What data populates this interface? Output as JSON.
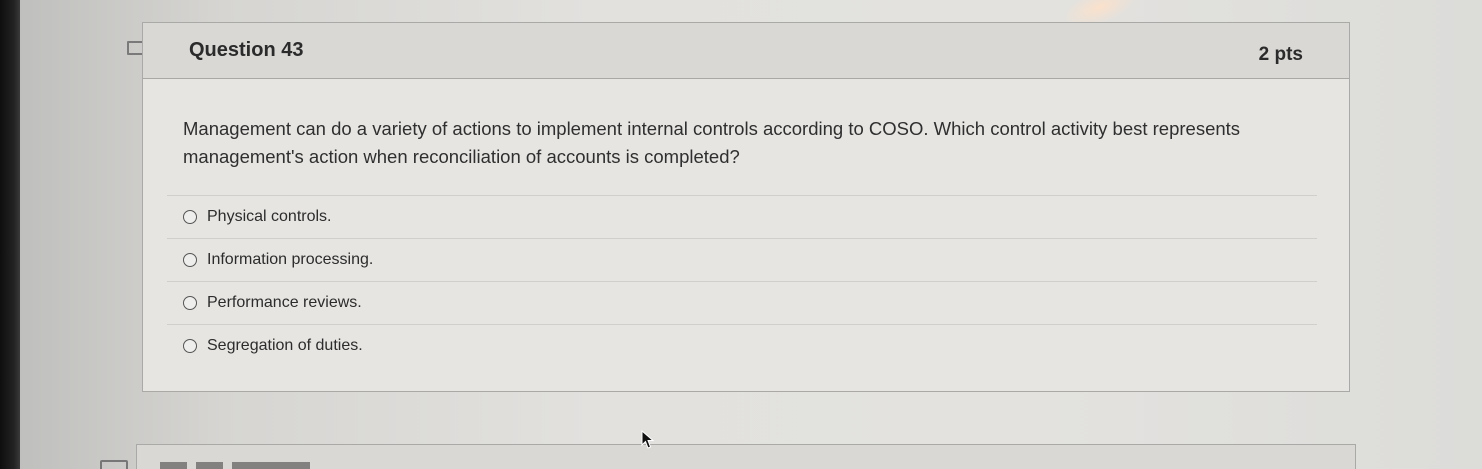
{
  "question": {
    "title": "Question 43",
    "points": "2 pts",
    "text": "Management can do a variety of actions to implement internal controls according to COSO. Which control activity best represents management's action when reconciliation of accounts is completed?",
    "answers": [
      {
        "label": "Physical controls."
      },
      {
        "label": "Information processing."
      },
      {
        "label": "Performance reviews."
      },
      {
        "label": "Segregation of duties."
      }
    ]
  },
  "icons": {
    "flag": "bookmark-flag-icon",
    "radio": "radio-unselected-icon",
    "cursor": "mouse-pointer-icon"
  },
  "colors": {
    "card_background": "#e6e5e2",
    "header_background": "#d9d8d5",
    "border": "#a9a9a7",
    "text": "#2b2b2b"
  }
}
